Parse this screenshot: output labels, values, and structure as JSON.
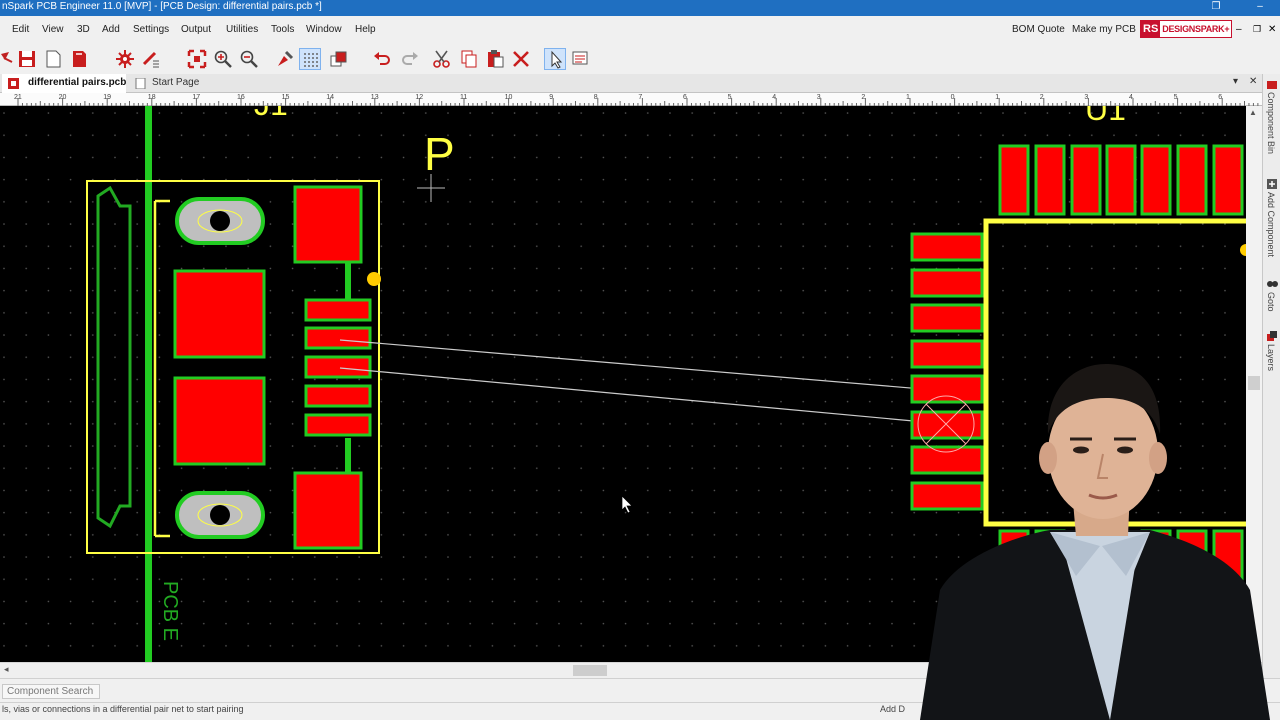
{
  "window": {
    "title": "nSpark PCB Engineer 11.0  [MVP] - [PCB Design: differential pairs.pcb *]"
  },
  "menu": [
    "Edit",
    "View",
    "3D",
    "Add",
    "Settings",
    "Output",
    "Utilities",
    "Tools",
    "Window",
    "Help"
  ],
  "header_links": {
    "bom_quote": "BOM Quote",
    "make_pcb": "Make my PCB"
  },
  "brand": {
    "rs": "RS",
    "name": "DESIGNSPARK",
    "plus": "+"
  },
  "tabs": [
    {
      "label": "differential pairs.pcb",
      "active": true
    },
    {
      "label": "Start Page",
      "active": false
    }
  ],
  "ruler": {
    "labels": [
      "21",
      "20",
      "19",
      "18",
      "17",
      "16",
      "15",
      "14",
      "13",
      "12",
      "11",
      "10",
      "9",
      "8",
      "7",
      "6",
      "5",
      "4",
      "3",
      "2",
      "1",
      "0",
      "1",
      "2",
      "3",
      "4",
      "5",
      "6"
    ]
  },
  "canvas": {
    "component_letter": "P",
    "silkscreen_text": "PCB E",
    "top_partial_left": "J1",
    "top_partial_right": "U1"
  },
  "right_panel": {
    "tabs": [
      "Component Bin",
      "Add Component",
      "Goto",
      "Layers"
    ]
  },
  "bottom": {
    "component_search_tab": "Component Search",
    "status_text": "ls, vias or connections in a differential pair net to start pairing",
    "status_right": "Add D"
  },
  "colors": {
    "title_bar": "#1f6fc1",
    "canvas_bg": "#000000",
    "pad_red": "#ff0000",
    "pad_outline_green": "#22cc22",
    "silkscreen_yellow": "#ffff44",
    "track_green": "#22cc22",
    "ratsnest": "#cccccc",
    "brand_red": "#c8102e"
  },
  "icons": [
    "new-icon",
    "save-icon",
    "open-icon",
    "close-doc-icon",
    "design-rules-icon",
    "check-icon",
    "zoom-fit-icon",
    "zoom-in-icon",
    "zoom-out-icon",
    "pan-icon",
    "grid-icon",
    "layers-icon",
    "undo-icon",
    "redo-icon",
    "cut-icon",
    "copy-icon",
    "paste-icon",
    "delete-icon",
    "select-icon",
    "properties-icon"
  ]
}
